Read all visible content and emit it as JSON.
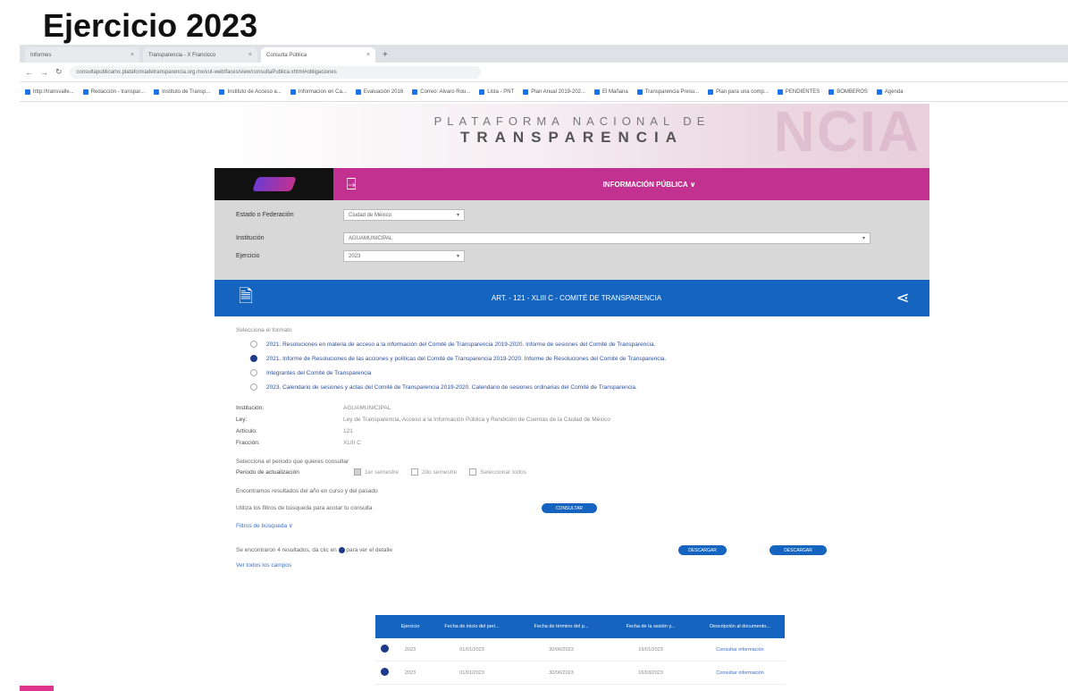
{
  "slide_title": "Ejercicio 2023",
  "browser": {
    "tabs": [
      {
        "label": "Informes",
        "active": false
      },
      {
        "label": "Transparencia - X Francisco",
        "active": false
      },
      {
        "label": "Consulta Pública",
        "active": true
      }
    ],
    "url": "consultapublicamx.plataformadetransparencia.org.mx/vut-web/faces/view/consultaPublica.xhtml#obligaciones",
    "bookmarks": [
      "http://transvalle...",
      "Redacción - transpar...",
      "Instituto de Transp...",
      "Instituto de Acceso a...",
      "Informacion en Ca...",
      "Evaluación 2016",
      "Correo: Alvaro Rou...",
      "Lista - PNT",
      "Plan Anual 2019-202...",
      "El Mañana",
      "Transparencia Presu...",
      "Plan para una comp...",
      "PENDIENTES",
      "BOMBEROS",
      "Agenda"
    ]
  },
  "hero": {
    "line1": "PLATAFORMA NACIONAL DE",
    "line2": "TRANSPARENCIA",
    "bg_word": "NCIA"
  },
  "nav": {
    "info_label": "INFORMACIÓN PÚBLICA"
  },
  "filters": {
    "estado_label": "Estado o Federación",
    "estado_value": "Ciudad de México",
    "institucion_label": "Institución",
    "institucion_value": "AGUAMUNICIPAL",
    "ejercicio_label": "Ejercicio",
    "ejercicio_value": "2023"
  },
  "article": {
    "label": "ART. - 121 - XLIII C - COMITÉ DE TRANSPARENCIA"
  },
  "formats": {
    "section_label": "Selecciona el formato",
    "items": [
      {
        "label": "2021. Resoluciones en materia de acceso a la información del Comité de Transparencia 2019-2020. Informe de sesiones del Comité de Transparencia.",
        "selected": false
      },
      {
        "label": "2021. Informe de Resoluciones de las acciones y políticas del Comité de Transparencia 2019-2020. Informe de Resoluciones del Comité de Transparencia.",
        "selected": true
      },
      {
        "label": "Integrantes del Comité de Transparencia",
        "selected": false
      },
      {
        "label": "2023. Calendario de sesiones y actas del Comité de Transparencia 2019-2020. Calendario de sesiones ordinarias del Comité de Transparencia.",
        "selected": false
      }
    ]
  },
  "meta": {
    "institucion_k": "Institución:",
    "institucion_v": "AGUAMUNICIPAL",
    "ley_k": "Ley:",
    "ley_v": "Ley de Transparencia, Acceso a la Información Pública y Rendición de Cuentas de la Ciudad de México",
    "articulo_k": "Artículo:",
    "articulo_v": "121",
    "fraccion_k": "Fracción:",
    "fraccion_v": "XLIII C"
  },
  "period": {
    "hint": "Selecciona el periodo que quieres consultar",
    "label": "Periodo de actualización",
    "options": [
      "1er semestre",
      "2do semestre",
      "Seleccionar todos"
    ]
  },
  "search": {
    "hint": "Encontramos resultados del año en curso y del pasado",
    "filters_hint": "Utiliza los filtros de búsqueda para acotar tu consulta",
    "consult_btn": "CONSULTAR",
    "filters_link": "Filtros de búsqueda ∨",
    "results_text": "Se encontraron 4 resultados, da clic en",
    "results_link": "para ver el detalle",
    "see_all": "Ver todos los campos",
    "btn_excel": "DESCARGAR",
    "btn_pdf": "DESCARGAR"
  },
  "table": {
    "headers": [
      "",
      "Ejercicio",
      "Fecha de inicio del peri...",
      "Fecha de término del p...",
      "Fecha de la sesión y...",
      "Descripción al documento..."
    ],
    "rows": [
      [
        "2023",
        "01/01/2023",
        "30/06/2023",
        "19/01/2023",
        "Consultar información"
      ],
      [
        "2023",
        "01/01/2023",
        "30/06/2023",
        "16/03/2023",
        "Consultar información"
      ]
    ]
  },
  "colors": {
    "pink": "#c2318f",
    "blue": "#1565c0",
    "filters_bg": "#d8d8d8"
  }
}
